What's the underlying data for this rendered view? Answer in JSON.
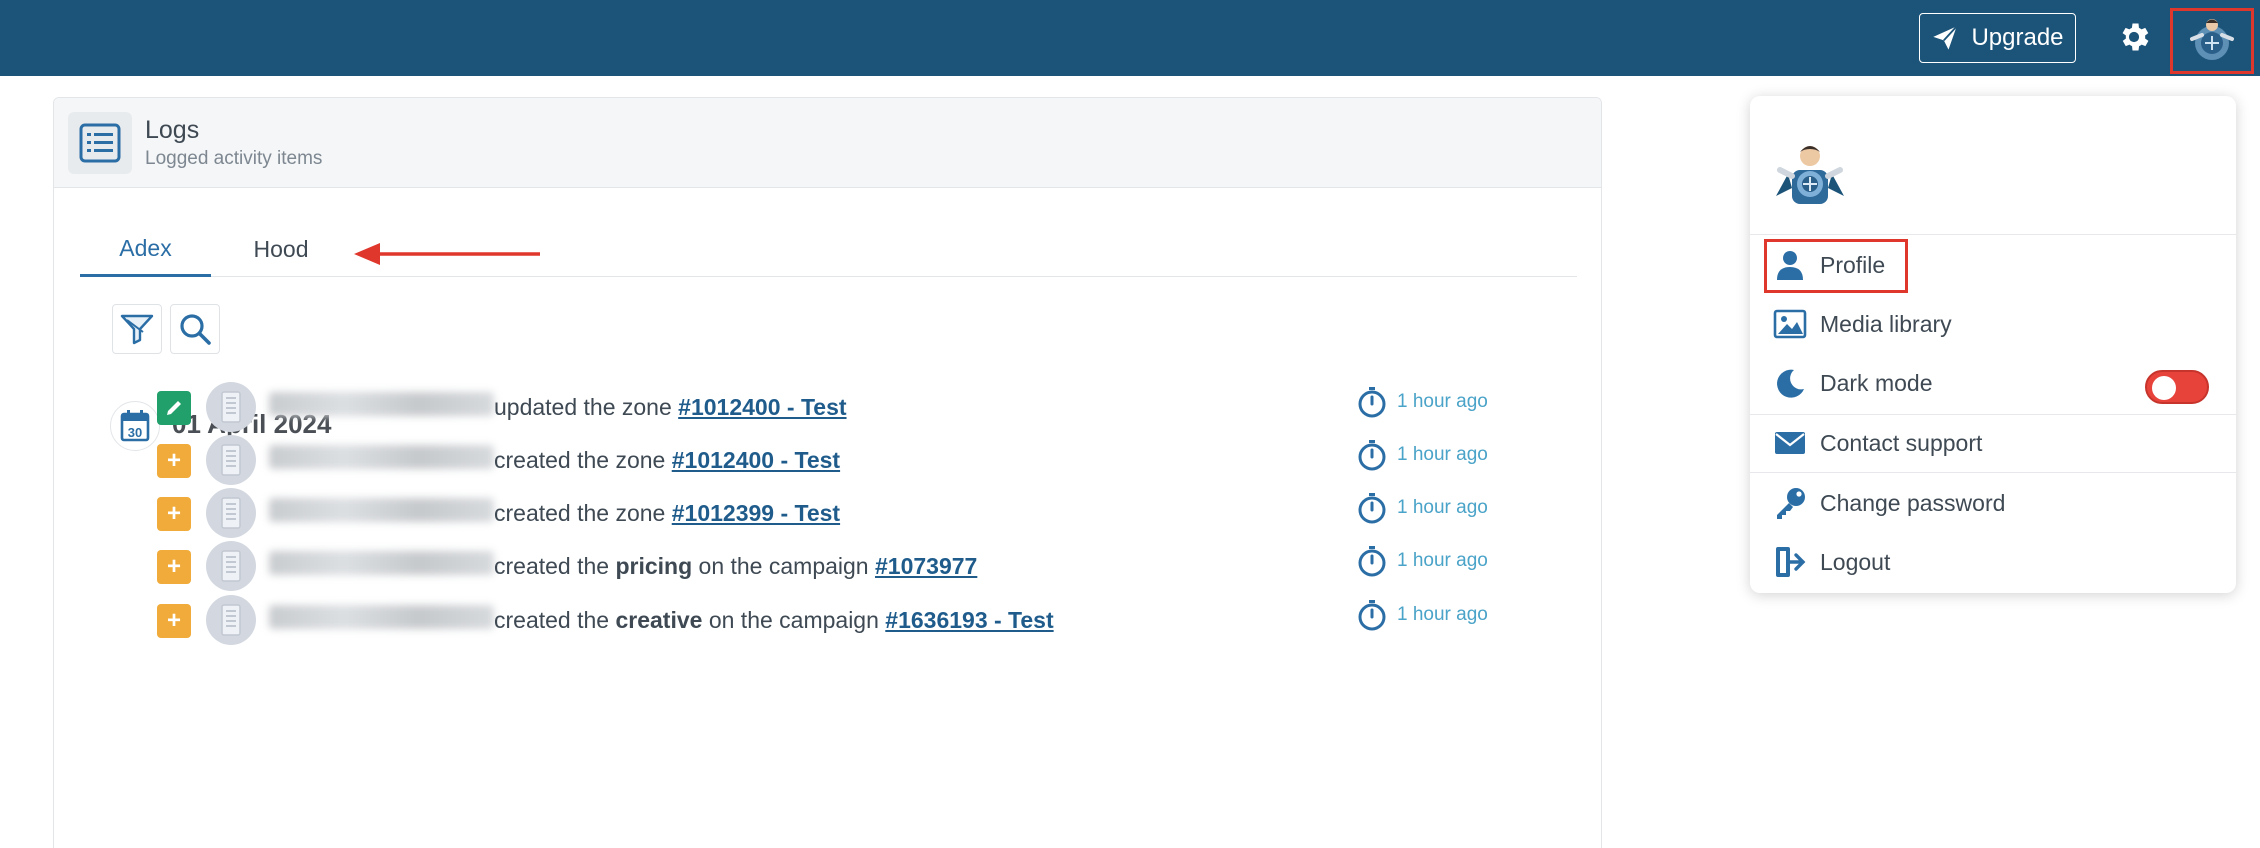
{
  "topbar": {
    "upgrade_label": "Upgrade"
  },
  "panel": {
    "title": "Logs",
    "subtitle": "Logged activity items",
    "tabs": [
      {
        "label": "Adex",
        "active": true
      },
      {
        "label": "Hood",
        "active": false
      }
    ],
    "date": "01 April 2024",
    "entries": [
      {
        "action": "edit",
        "parts": [
          {
            "t": "updated the zone "
          },
          {
            "link": "#1012400 - Test"
          }
        ],
        "time": "1 hour ago"
      },
      {
        "action": "add",
        "parts": [
          {
            "t": "created the zone "
          },
          {
            "link": "#1012400 - Test"
          }
        ],
        "time": "1 hour ago"
      },
      {
        "action": "add",
        "parts": [
          {
            "t": "created the zone "
          },
          {
            "link": "#1012399 - Test"
          }
        ],
        "time": "1 hour ago"
      },
      {
        "action": "add",
        "parts": [
          {
            "t": "created the "
          },
          {
            "b": "pricing"
          },
          {
            "t": " on the campaign "
          },
          {
            "link": "#1073977"
          }
        ],
        "time": "1 hour ago"
      },
      {
        "action": "add",
        "parts": [
          {
            "t": "created the "
          },
          {
            "b": "creative"
          },
          {
            "t": " on the campaign "
          },
          {
            "link": "#1636193 - Test"
          }
        ],
        "time": "1 hour ago"
      }
    ]
  },
  "dropdown": {
    "items": [
      {
        "label": "Profile",
        "icon": "user-icon"
      },
      {
        "label": "Media library",
        "icon": "image-icon"
      },
      {
        "label": "Dark mode",
        "icon": "moon-icon",
        "toggle": true,
        "toggle_on": false
      },
      {
        "label": "Contact support",
        "icon": "envelope-icon"
      },
      {
        "label": "Change password",
        "icon": "key-icon"
      },
      {
        "label": "Logout",
        "icon": "logout-icon"
      }
    ]
  },
  "colors": {
    "topbar": "#1c5479",
    "accent": "#2b6ea6",
    "edit_badge": "#22a06b",
    "add_badge": "#f0ab3b",
    "toggle": "#e8433a",
    "highlight": "#e0372c"
  }
}
